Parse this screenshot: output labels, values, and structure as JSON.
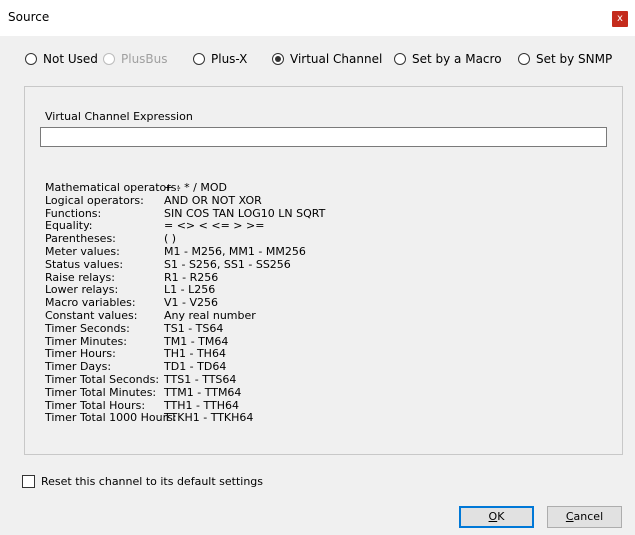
{
  "window": {
    "title": "Source",
    "close_glyph": "x"
  },
  "source_options": [
    {
      "label": "Not Used",
      "checked": false,
      "disabled": false
    },
    {
      "label": "PlusBus",
      "checked": false,
      "disabled": true
    },
    {
      "label": "Plus-X",
      "checked": false,
      "disabled": false
    },
    {
      "label": "Virtual Channel",
      "checked": true,
      "disabled": false
    },
    {
      "label": "Set by a Macro",
      "checked": false,
      "disabled": false
    },
    {
      "label": "Set by SNMP",
      "checked": false,
      "disabled": false
    }
  ],
  "expression": {
    "label": "Virtual Channel Expression",
    "value": ""
  },
  "operators": [
    {
      "key": "Mathematical operators:",
      "value": "+ - * / MOD"
    },
    {
      "key": "Logical operators:",
      "value": "AND OR NOT XOR"
    },
    {
      "key": "Functions:",
      "value": "SIN COS TAN LOG10 LN SQRT"
    },
    {
      "key": "Equality:",
      "value": "= <> < <= > >="
    },
    {
      "key": "Parentheses:",
      "value": "( )"
    },
    {
      "key": "Meter values:",
      "value": "M1 - M256, MM1 - MM256"
    },
    {
      "key": "Status values:",
      "value": "S1 - S256, SS1 - SS256"
    },
    {
      "key": "Raise relays:",
      "value": "R1 - R256"
    },
    {
      "key": "Lower relays:",
      "value": "L1 - L256"
    },
    {
      "key": "Macro variables:",
      "value": "V1 - V256"
    },
    {
      "key": "Constant values:",
      "value": "Any real number"
    },
    {
      "key": "Timer Seconds:",
      "value": "TS1 - TS64"
    },
    {
      "key": "Timer Minutes:",
      "value": "TM1 - TM64"
    },
    {
      "key": "Timer Hours:",
      "value": "TH1 - TH64"
    },
    {
      "key": "Timer Days:",
      "value": "TD1 - TD64"
    },
    {
      "key": "Timer Total Seconds:",
      "value": "TTS1 - TTS64"
    },
    {
      "key": "Timer Total Minutes:",
      "value": "TTM1 - TTM64"
    },
    {
      "key": "Timer Total Hours:",
      "value": "TTH1 - TTH64"
    },
    {
      "key": "Timer Total 1000 Hours:",
      "value": "TTKH1 - TTKH64"
    }
  ],
  "reset": {
    "label": "Reset this channel to its default settings",
    "checked": false
  },
  "buttons": {
    "ok_mnemonic": "O",
    "ok_rest": "K",
    "cancel_mnemonic": "C",
    "cancel_rest": "ancel"
  }
}
